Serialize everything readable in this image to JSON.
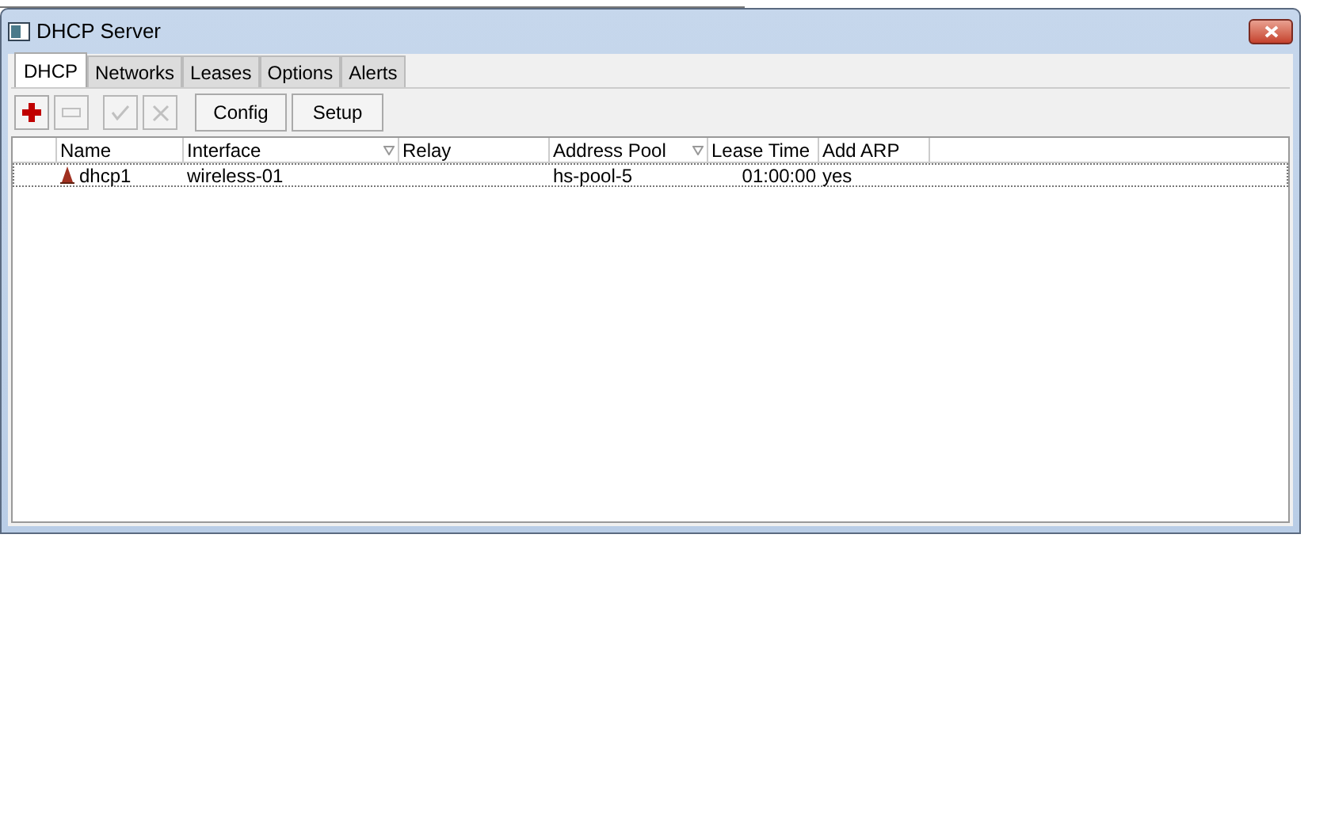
{
  "window": {
    "title": "DHCP Server"
  },
  "tabs": [
    {
      "label": "DHCP",
      "selected": true
    },
    {
      "label": "Networks",
      "selected": false
    },
    {
      "label": "Leases",
      "selected": false
    },
    {
      "label": "Options",
      "selected": false
    },
    {
      "label": "Alerts",
      "selected": false
    }
  ],
  "toolbar": {
    "icon_buttons": [
      {
        "kind": "add",
        "disabled": false
      },
      {
        "kind": "remove",
        "disabled": true
      },
      {
        "kind": "enable",
        "disabled": true
      },
      {
        "kind": "disable",
        "disabled": true
      }
    ],
    "buttons": [
      "Config",
      "Setup"
    ]
  },
  "table": {
    "columns": [
      {
        "label": "Name",
        "sort": false
      },
      {
        "label": "Interface",
        "sort": true
      },
      {
        "label": "Relay",
        "sort": false
      },
      {
        "label": "Address Pool",
        "sort": true
      },
      {
        "label": "Lease Time",
        "sort": false
      },
      {
        "label": "Add ARP",
        "sort": false
      }
    ],
    "rows": [
      {
        "cells": [
          "dhcp1",
          "wireless-01",
          "",
          "hs-pool-5",
          "01:00:00",
          "yes"
        ],
        "selected": true
      }
    ]
  }
}
